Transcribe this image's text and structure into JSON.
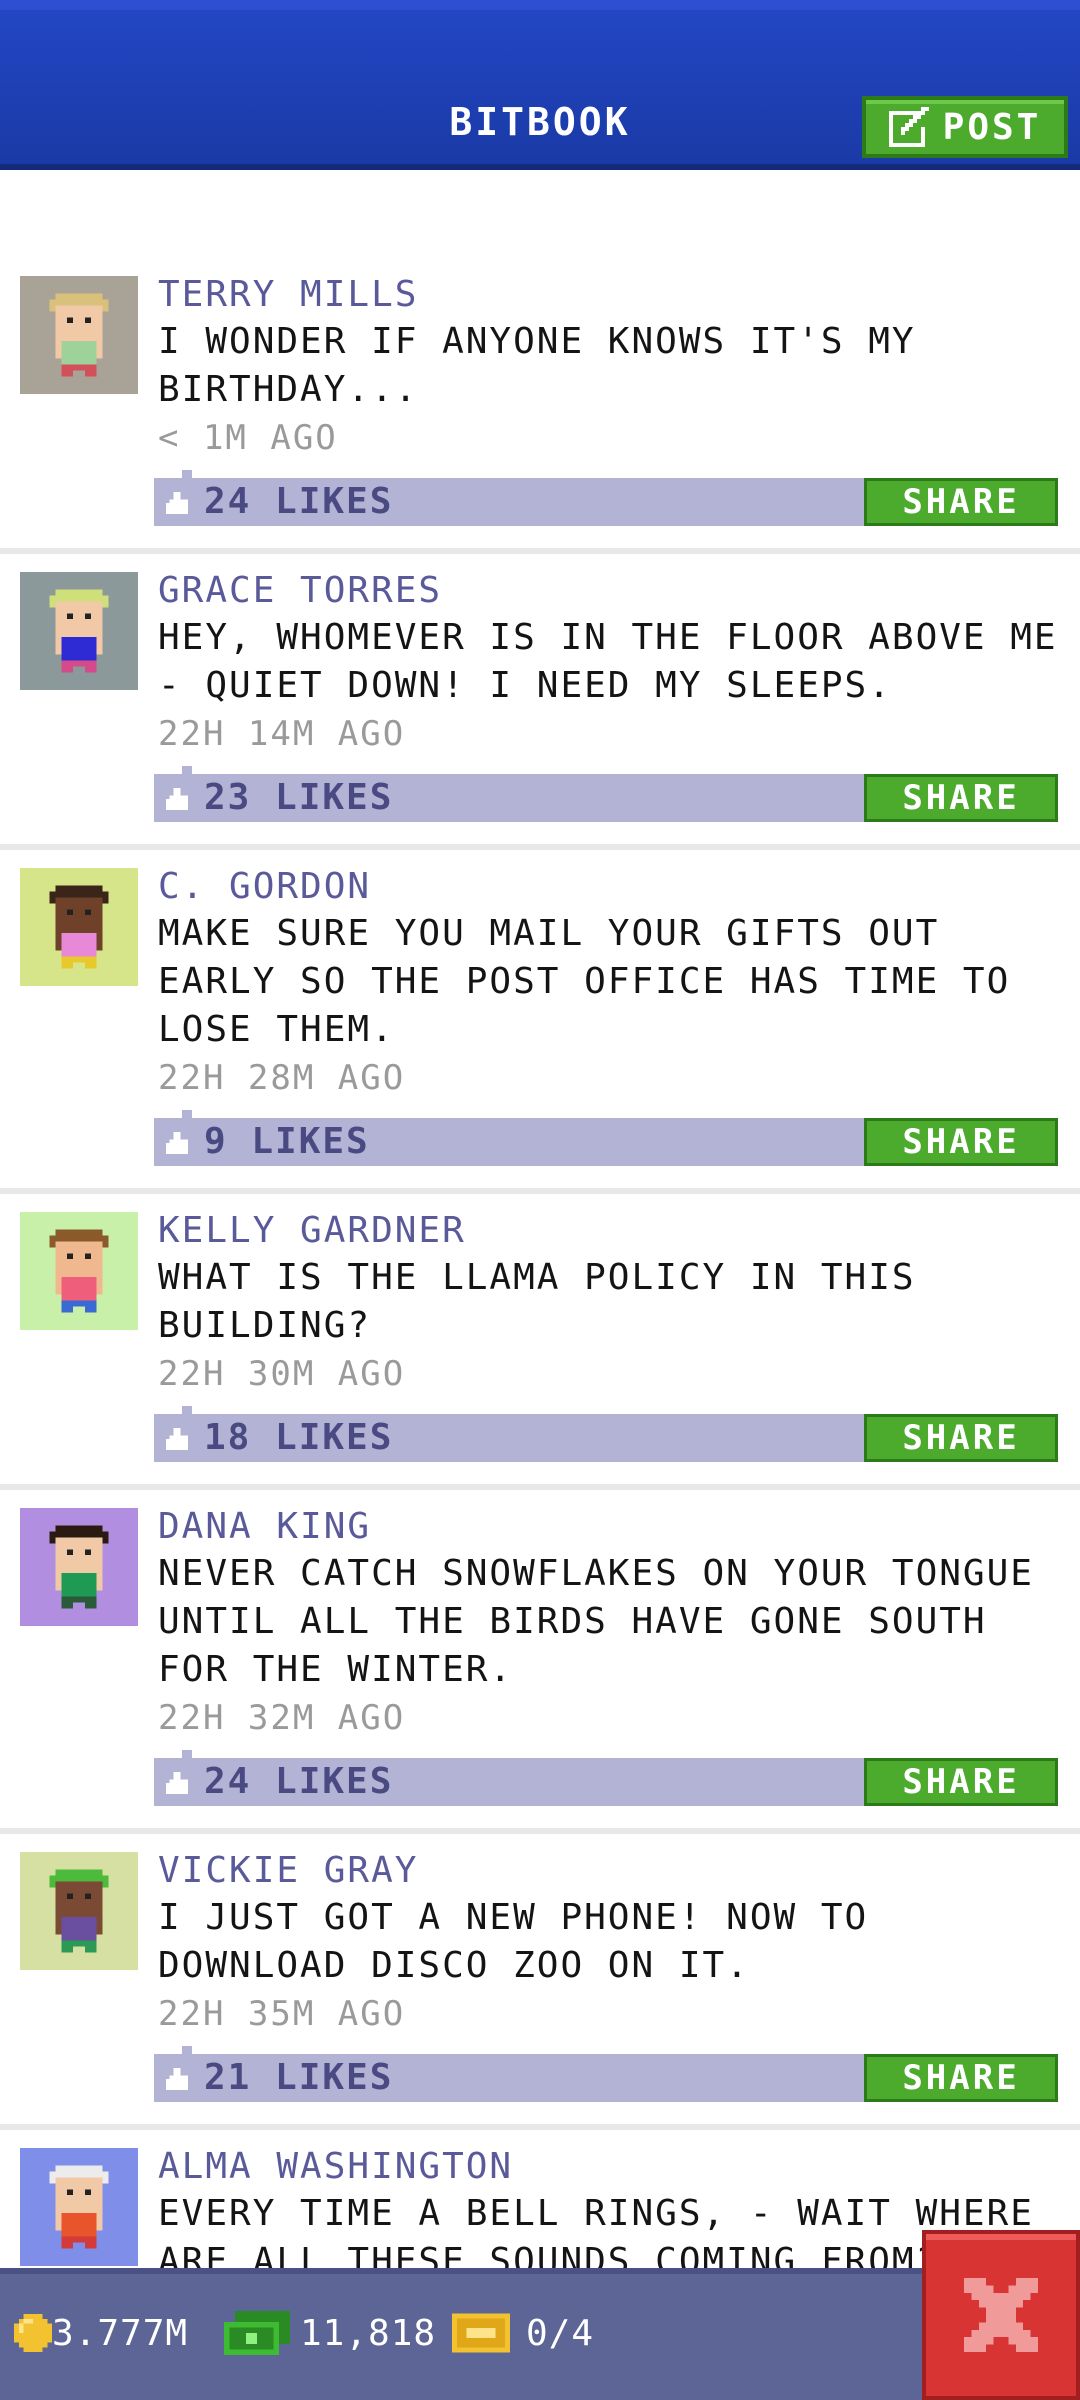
{
  "header": {
    "title": "BITBOOK",
    "post_button_label": "POST"
  },
  "posts": [
    {
      "author": "TERRY MILLS",
      "message": "I WONDER IF ANYONE KNOWS IT'S MY BIRTHDAY...",
      "time": "< 1M AGO",
      "likes": "24 LIKES",
      "share_label": "SHARE",
      "avatar": {
        "bg": "#a9a297",
        "hair": "#d9c17c",
        "skin": "#f2c9a6",
        "shirt": "#9fd29a",
        "pants": "#d2505a"
      }
    },
    {
      "author": "GRACE TORRES",
      "message": "HEY, WHOMEVER IS IN THE FLOOR ABOVE ME - QUIET DOWN! I NEED MY SLEEPS.",
      "time": "22H 14M AGO",
      "likes": "23 LIKES",
      "share_label": "SHARE",
      "avatar": {
        "bg": "#8c999a",
        "hair": "#cfe07a",
        "skin": "#f2c9a6",
        "shirt": "#2e2ad4",
        "pants": "#d44a8a"
      }
    },
    {
      "author": "C. GORDON",
      "message": "MAKE SURE YOU MAIL YOUR GIFTS OUT EARLY SO THE POST OFFICE HAS TIME TO LOSE THEM.",
      "time": "22H 28M AGO",
      "likes": "9 LIKES",
      "share_label": "SHARE",
      "avatar": {
        "bg": "#d6e58a",
        "hair": "#3b2418",
        "skin": "#6e4128",
        "shirt": "#e889d8",
        "pants": "#e8c92c"
      }
    },
    {
      "author": "KELLY GARDNER",
      "message": "WHAT IS THE LLAMA POLICY IN THIS BUILDING?",
      "time": "22H 30M AGO",
      "likes": "18 LIKES",
      "share_label": "SHARE",
      "avatar": {
        "bg": "#c9f0a8",
        "hair": "#8a5a2a",
        "skin": "#f0b88e",
        "shirt": "#ef5f7c",
        "pants": "#3a6ad4"
      }
    },
    {
      "author": "DANA KING",
      "message": "NEVER CATCH SNOWFLAKES ON YOUR TONGUE UNTIL ALL THE BIRDS HAVE GONE SOUTH FOR THE WINTER.",
      "time": "22H 32M AGO",
      "likes": "24 LIKES",
      "share_label": "SHARE",
      "avatar": {
        "bg": "#b18ee0",
        "hair": "#2a1a12",
        "skin": "#f2c9a6",
        "shirt": "#1f9a54",
        "pants": "#2a5a3a"
      }
    },
    {
      "author": "VICKIE GRAY",
      "message": "I JUST GOT A NEW PHONE! NOW TO DOWNLOAD DISCO ZOO ON IT.",
      "time": "22H 35M AGO",
      "likes": "21 LIKES",
      "share_label": "SHARE",
      "avatar": {
        "bg": "#d6e0a2",
        "hair": "#4cba3a",
        "skin": "#7a4a34",
        "shirt": "#6a4ea0",
        "pants": "#2c9a54"
      }
    },
    {
      "author": "ALMA WASHINGTON",
      "message": "EVERY TIME A BELL RINGS, - WAIT WHERE ARE ALL THESE SOUNDS COMING FROM?",
      "time": "",
      "likes": "",
      "share_label": "SHARE",
      "avatar": {
        "bg": "#7f8ee8",
        "hair": "#ececec",
        "skin": "#f2c9a6",
        "shirt": "#e8542c",
        "pants": "#d43a3a"
      }
    }
  ],
  "bottom_bar": {
    "coins": "3.777M",
    "bucks": "11,818",
    "tickets": "0/4"
  },
  "colors": {
    "header_blue": "#1a3aa6",
    "button_green": "#4caa2c",
    "like_bar": "#b3b3d6",
    "author_text": "#5a5a9a",
    "close_red": "#d83434"
  },
  "icons": [
    "edit-icon",
    "like-icon",
    "coin-icon",
    "cash-icon",
    "ticket-icon",
    "close-icon"
  ]
}
